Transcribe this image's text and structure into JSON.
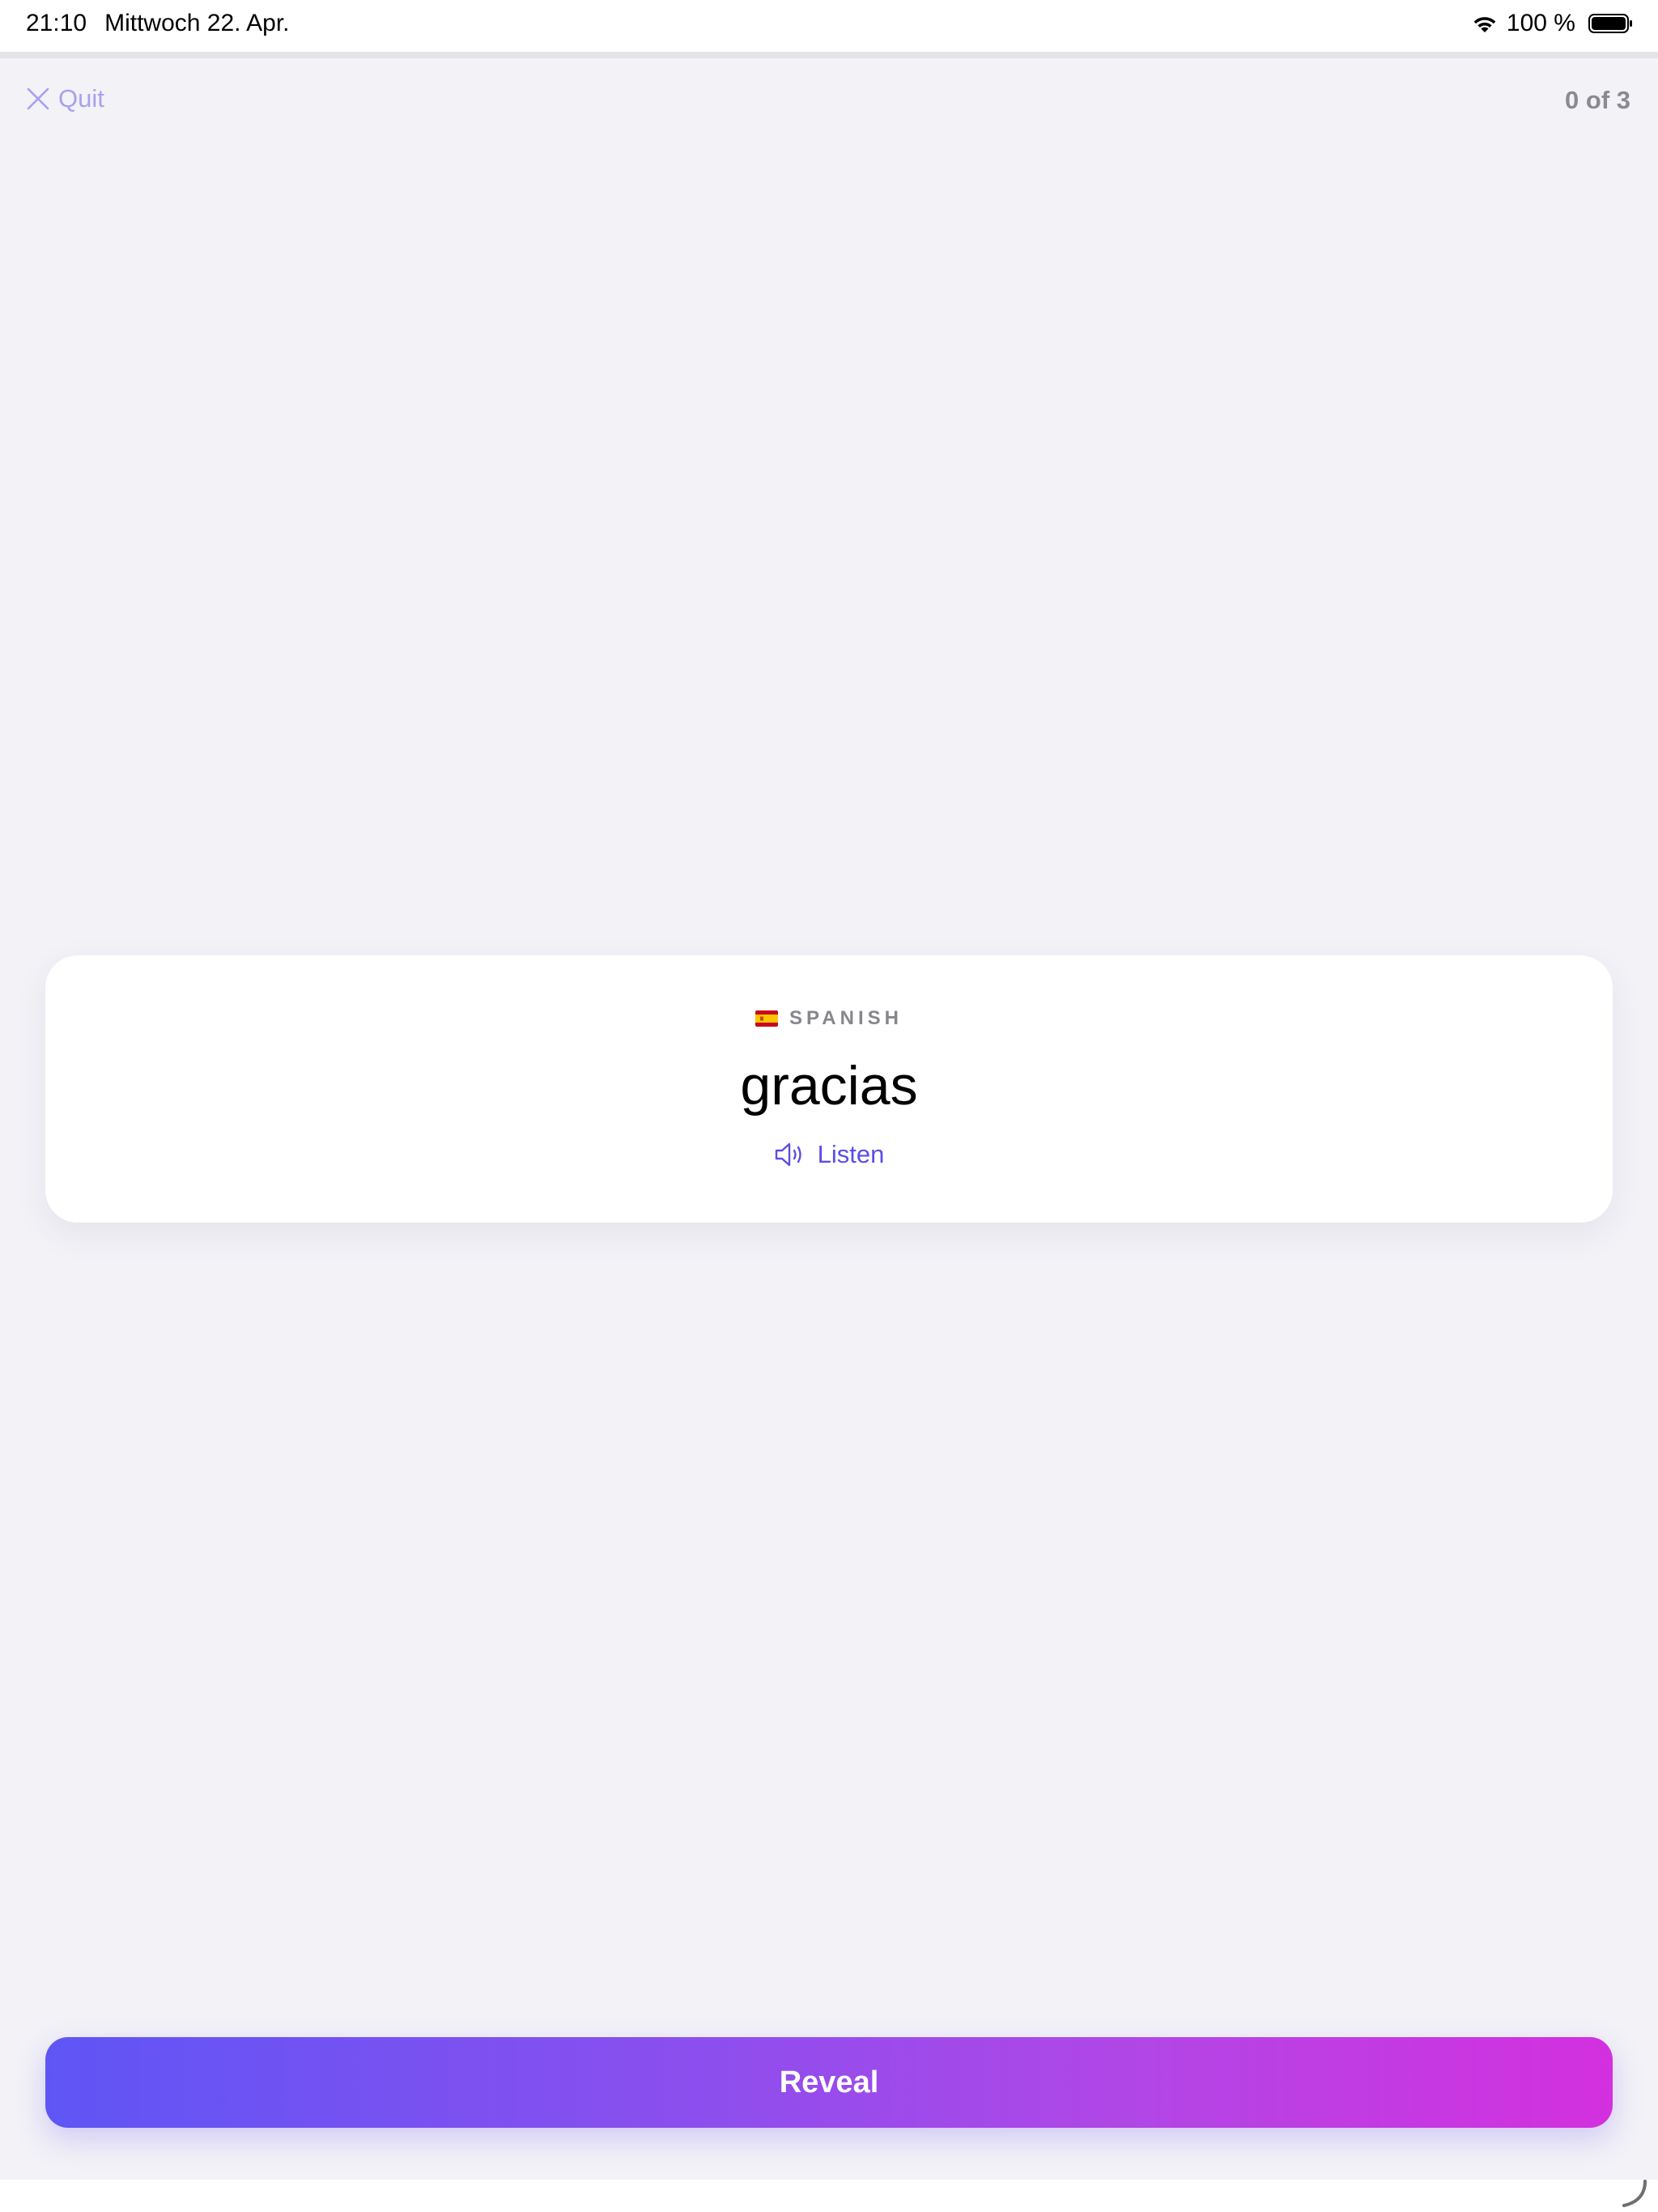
{
  "status_bar": {
    "time": "21:10",
    "date": "Mittwoch 22. Apr.",
    "battery": "100 %",
    "icons": [
      "wifi-icon",
      "battery-icon"
    ]
  },
  "nav": {
    "quit_label": "Quit",
    "quit_icon": "close-icon",
    "progress": "0 of 3"
  },
  "card": {
    "language_flag_icon": "spain-flag-icon",
    "language_label": "SPANISH",
    "word": "gracias",
    "listen_label": "Listen",
    "listen_icon": "speaker-icon"
  },
  "actions": {
    "reveal_label": "Reveal"
  },
  "colors": {
    "background": "#f2f2f7",
    "accent": "#5b4ee6",
    "gradient_start": "#5f55f5",
    "gradient_end": "#d330df",
    "quit": "#a8a0ee"
  }
}
